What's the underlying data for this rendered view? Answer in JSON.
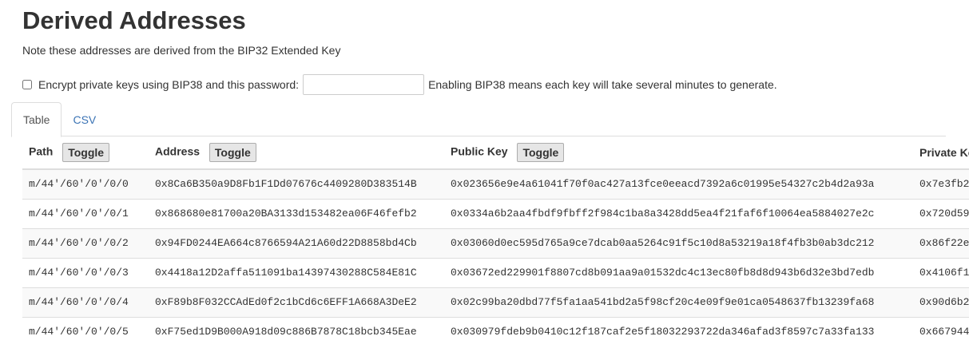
{
  "header": {
    "title": "Derived Addresses",
    "note": "Note these addresses are derived from the BIP32 Extended Key"
  },
  "bip38": {
    "checkbox_label": "Encrypt private keys using BIP38 and this password:",
    "password_value": "",
    "hint": "Enabling BIP38 means each key will take several minutes to generate."
  },
  "tabs": [
    {
      "label": "Table",
      "active": true
    },
    {
      "label": "CSV",
      "active": false
    }
  ],
  "table": {
    "columns": {
      "path": "Path",
      "address": "Address",
      "public_key": "Public Key",
      "private_key": "Private Key"
    },
    "toggle_label": "Toggle",
    "rows": [
      {
        "path": "m/44'/60'/0'/0/0",
        "address": "0x8Ca6B350a9D8Fb1F1Dd07676c4409280D383514B",
        "public_key": "0x023656e9e4a61041f70f0ac427a13fce0eeacd7392a6c01995e54327c2b4d2a93a",
        "private_key": "0x7e3fb2"
      },
      {
        "path": "m/44'/60'/0'/0/1",
        "address": "0x868680e81700a20BA3133d153482ea06F46fefb2",
        "public_key": "0x0334a6b2aa4fbdf9fbff2f984c1ba8a3428dd5ea4f21faf6f10064ea5884027e2c",
        "private_key": "0x720d59"
      },
      {
        "path": "m/44'/60'/0'/0/2",
        "address": "0x94FD0244EA664c8766594A21A60d22D8858bd4Cb",
        "public_key": "0x03060d0ec595d765a9ce7dcab0aa5264c91f5c10d8a53219a18f4fb3b0ab3dc212",
        "private_key": "0x86f22e"
      },
      {
        "path": "m/44'/60'/0'/0/3",
        "address": "0x4418a12D2affa511091ba14397430288C584E81C",
        "public_key": "0x03672ed229901f8807cd8b091aa9a01532dc4c13ec80fb8d8d943b6d32e3bd7edb",
        "private_key": "0x4106f1"
      },
      {
        "path": "m/44'/60'/0'/0/4",
        "address": "0xF89b8F032CCAdEd0f2c1bCd6c6EFF1A668A3DeE2",
        "public_key": "0x02c99ba20dbd77f5fa1aa541bd2a5f98cf20c4e09f9e01ca0548637fb13239fa68",
        "private_key": "0x90d6b2"
      },
      {
        "path": "m/44'/60'/0'/0/5",
        "address": "0xF75ed1D9B000A918d09c886B7878C18bcb345Eae",
        "public_key": "0x030979fdeb9b0410c12f187caf2e5f18032293722da346afad3f8597c7a33fa133",
        "private_key": "0x667944"
      }
    ]
  }
}
